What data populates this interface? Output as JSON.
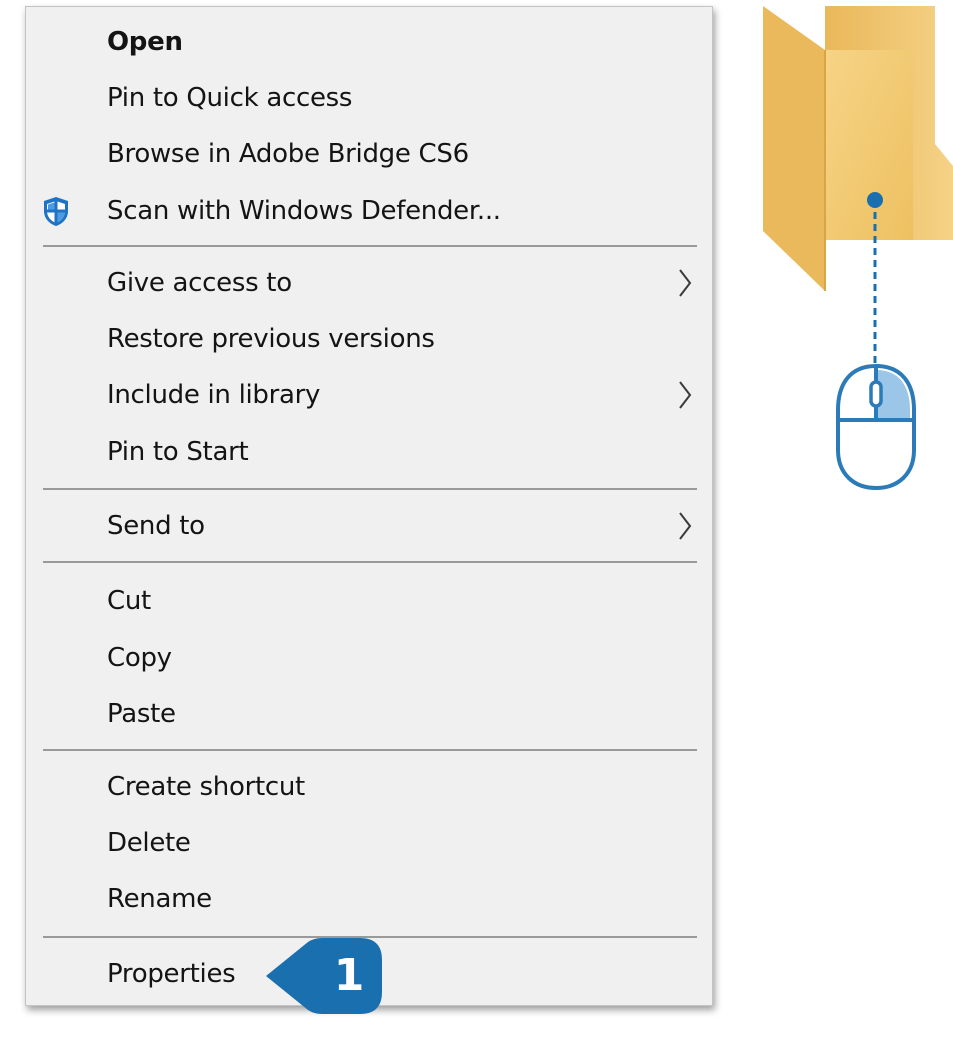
{
  "menu": {
    "items": [
      {
        "label": "Open"
      },
      {
        "label": "Pin to Quick access"
      },
      {
        "label": "Browse in Adobe Bridge CS6"
      },
      {
        "label": "Scan with Windows Defender...",
        "icon": "windows-defender-shield-icon"
      },
      {
        "label": "Give access to",
        "submenu": true
      },
      {
        "label": "Restore previous versions"
      },
      {
        "label": "Include in library",
        "submenu": true
      },
      {
        "label": "Pin to Start"
      },
      {
        "label": "Send to",
        "submenu": true
      },
      {
        "label": "Cut"
      },
      {
        "label": "Copy"
      },
      {
        "label": "Paste"
      },
      {
        "label": "Create shortcut"
      },
      {
        "label": "Delete"
      },
      {
        "label": "Rename"
      },
      {
        "label": "Properties"
      }
    ]
  },
  "callout": {
    "number": "1",
    "color": "#1a6fae"
  },
  "colors": {
    "menu_background": "#f0f0f0",
    "separator": "#9a9a9a",
    "folder": "#f3c96b",
    "mouse_outline": "#2b7bb9",
    "mouse_button_highlight": "#9cc6e8"
  },
  "icons": [
    "windows-defender-shield-icon",
    "chevron-right-icon",
    "folder-icon",
    "mouse-icon",
    "callout-badge"
  ]
}
